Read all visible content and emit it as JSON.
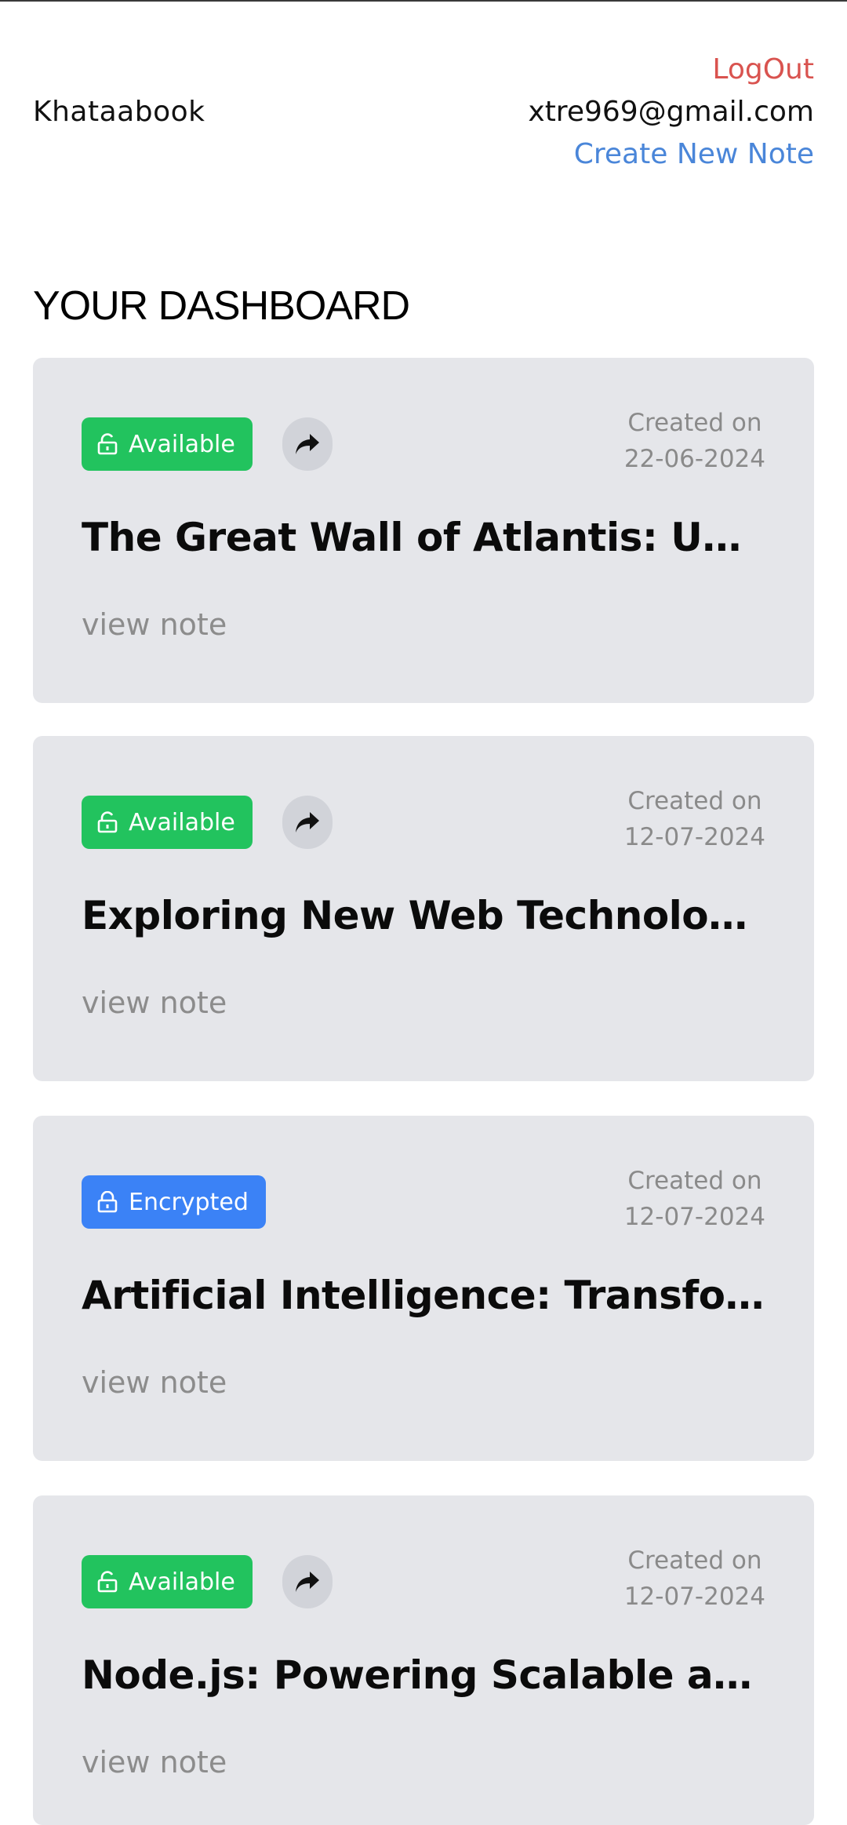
{
  "header": {
    "brand": "Khataabook",
    "logout_label": "LogOut",
    "email": "xtre969@gmail.com",
    "create_note_label": "Create New Note"
  },
  "dashboard": {
    "title": "YOUR DASHBOARD",
    "created_label": "Created on",
    "view_label": "view note",
    "notes": [
      {
        "status": "Available",
        "date": "22-06-2024",
        "title": "The Great Wall of Atlantis: Unveiling the Mysteries"
      },
      {
        "status": "Available",
        "date": "12-07-2024",
        "title": "Exploring New Web Technologies"
      },
      {
        "status": "Encrypted",
        "date": "12-07-2024",
        "title": "Artificial Intelligence: Transforming the Future"
      },
      {
        "status": "Available",
        "date": "12-07-2024",
        "title": "Node.js: Powering Scalable and Fast Applications"
      }
    ]
  },
  "colors": {
    "available": "#22c35e",
    "encrypted": "#3b82f6",
    "logout": "#d9534f",
    "link": "#4a86d9",
    "card_bg": "#e5e6ea"
  },
  "icons": {
    "unlocked": "lock-open-icon",
    "locked": "lock-icon",
    "share": "share-arrow-icon"
  }
}
